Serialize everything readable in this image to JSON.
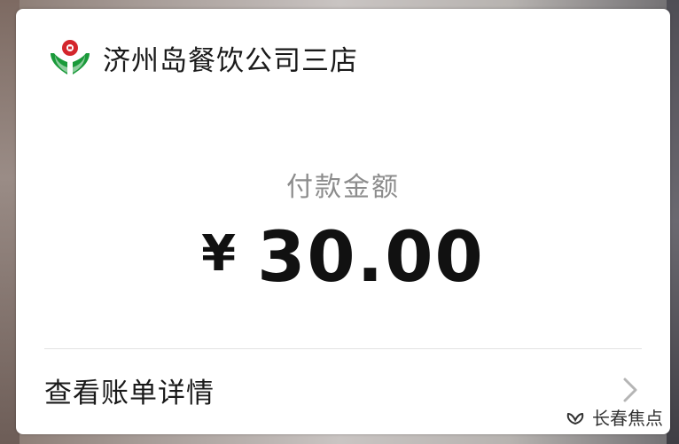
{
  "merchant": {
    "name": "济州岛餐饮公司三店",
    "logo_icon": "bank-logo-icon",
    "logo_color": "#1a9a3a",
    "logo_accent": "#d4262c"
  },
  "payment": {
    "label": "付款金额",
    "currency_symbol": "¥",
    "amount": "30.00"
  },
  "details": {
    "label": "查看账单详情",
    "chevron_icon": "chevron-right-icon"
  },
  "watermark": {
    "text": "长春焦点",
    "icon": "wechat-channel-icon"
  }
}
